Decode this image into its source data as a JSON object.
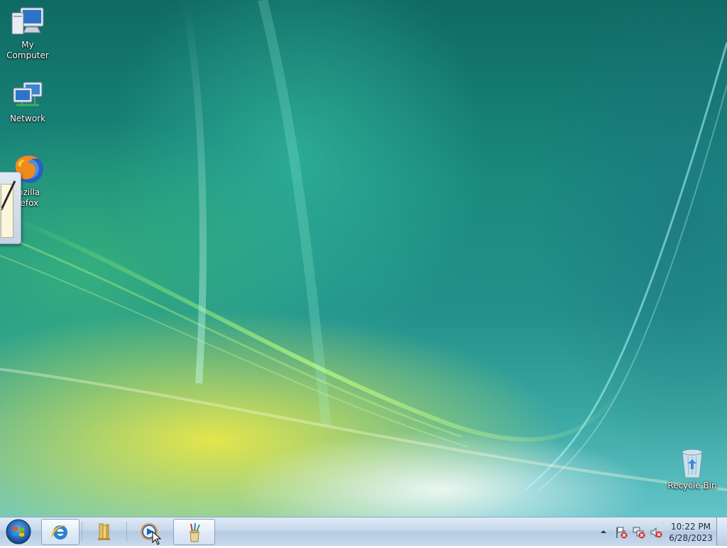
{
  "desktop": {
    "icons": [
      {
        "label": "My Computer",
        "icon": "computer-icon"
      },
      {
        "label": "Network",
        "icon": "network-icon"
      },
      {
        "label_line1": "Mozilla",
        "label_line2": "Firefox",
        "label_visible_line1": "lozilla",
        "label_visible_line2": "refox",
        "icon": "firefox-icon"
      },
      {
        "label": "Recycle Bin",
        "icon": "recycle-bin-icon"
      }
    ]
  },
  "taskbar": {
    "start": {
      "icon": "windows-start-orb-icon"
    },
    "pinned": [
      {
        "name": "internet-explorer",
        "icon": "internet-explorer-icon"
      },
      {
        "name": "libraries",
        "icon": "folder-library-icon"
      },
      {
        "name": "windows-media-player",
        "icon": "media-player-icon"
      },
      {
        "name": "paint-window",
        "icon": "paint-brushes-icon"
      }
    ],
    "tray": {
      "icons": [
        "show-hidden-icons-arrow",
        "action-center-flag-icon",
        "network-error-icon",
        "volume-muted-icon"
      ],
      "time": "10:22 PM",
      "date": "6/28/2023"
    }
  },
  "colors": {
    "taskbar": "#c5d7ea",
    "desktop_teal": "#1a8a7e",
    "desktop_yellow": "#ece846"
  }
}
